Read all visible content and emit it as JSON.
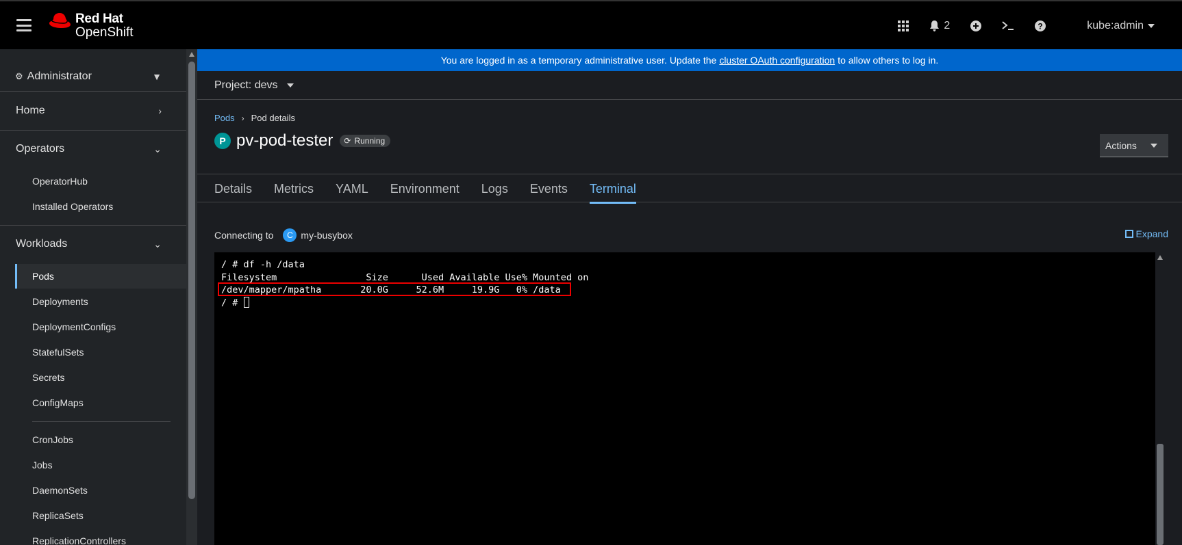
{
  "masthead": {
    "brand_line1": "Red Hat",
    "brand_line2": "OpenShift",
    "notification_count": "2",
    "user": "kube:admin"
  },
  "sidebar": {
    "perspective": "Administrator",
    "sections": {
      "home": "Home",
      "operators": "Operators",
      "workloads": "Workloads"
    },
    "operators_items": [
      "OperatorHub",
      "Installed Operators"
    ],
    "workloads_items": [
      "Pods",
      "Deployments",
      "DeploymentConfigs",
      "StatefulSets",
      "Secrets",
      "ConfigMaps",
      "CronJobs",
      "Jobs",
      "DaemonSets",
      "ReplicaSets",
      "ReplicationControllers"
    ]
  },
  "banner": {
    "text_before": "You are logged in as a temporary administrative user. Update the",
    "link": "cluster OAuth configuration",
    "text_after": "to allow others to log in."
  },
  "project": {
    "label": "Project: devs"
  },
  "breadcrumb": {
    "parent": "Pods",
    "current": "Pod details"
  },
  "pod": {
    "badge": "P",
    "name": "pv-pod-tester",
    "status": "Running"
  },
  "actions_label": "Actions",
  "tabs": [
    "Details",
    "Metrics",
    "YAML",
    "Environment",
    "Logs",
    "Events",
    "Terminal"
  ],
  "terminal": {
    "connecting_label": "Connecting to",
    "container_badge": "C",
    "container": "my-busybox",
    "expand_label": "Expand",
    "lines": [
      "/ # df -h /data",
      "Filesystem                Size      Used Available Use% Mounted on",
      "/dev/mapper/mpatha       20.0G     52.6M     19.9G   0% /data"
    ],
    "prompt": "/ # "
  },
  "colors": {
    "accent": "#73bcf7",
    "banner": "#0066cc",
    "pod_badge": "#009596",
    "highlight": "#ee0000"
  }
}
